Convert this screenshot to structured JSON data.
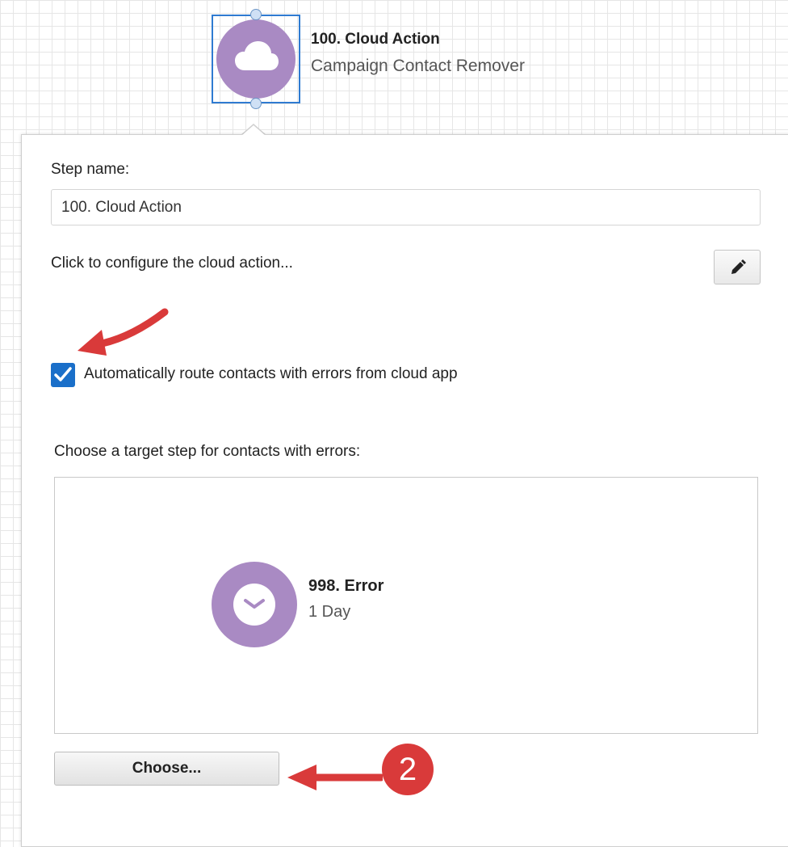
{
  "flow_step": {
    "title": "100. Cloud Action",
    "subtitle": "Campaign Contact Remover",
    "icon": "cloud-icon",
    "color": "#a98ac3",
    "selection_color": "#2f7bd1"
  },
  "panel": {
    "step_name_label": "Step name:",
    "step_name_value": "100. Cloud Action",
    "configure_label": "Click to configure the cloud action...",
    "edit_icon": "pencil-icon",
    "auto_route_checkbox": {
      "label": "Automatically route contacts with errors from cloud app",
      "checked": true,
      "color": "#1a6fc9"
    },
    "target_label": "Choose a target step for contacts with errors:",
    "target_step": {
      "title": "998. Error",
      "subtitle": "1 Day",
      "icon": "clock-icon"
    },
    "choose_button": "Choose..."
  },
  "annotations": {
    "badge_number": "2",
    "color": "#d93a3a"
  }
}
